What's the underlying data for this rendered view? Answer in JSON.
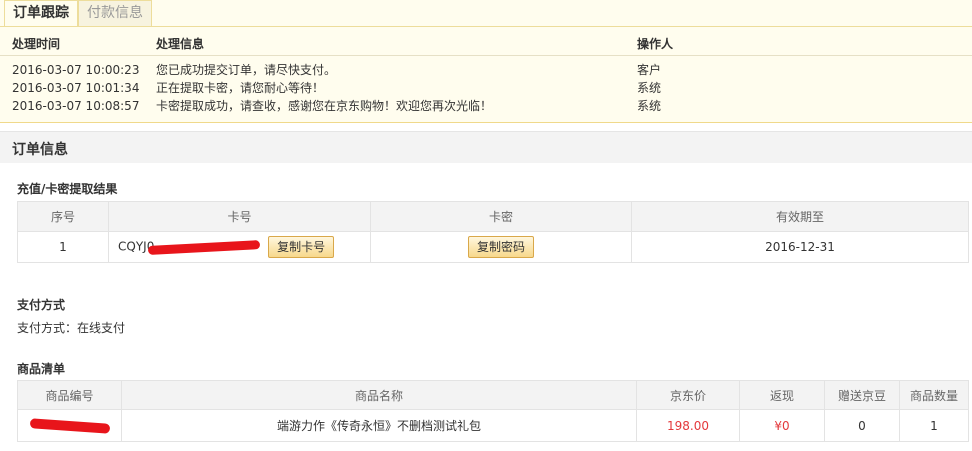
{
  "tabs": {
    "active": "订单跟踪",
    "inactive": "付款信息"
  },
  "track": {
    "headers": {
      "time": "处理时间",
      "info": "处理信息",
      "operator": "操作人"
    },
    "rows": [
      {
        "time": "2016-03-07 10:00:23",
        "info": "您已成功提交订单，请尽快支付。",
        "operator": "客户"
      },
      {
        "time": "2016-03-07 10:01:34",
        "info": "正在提取卡密，请您耐心等待！",
        "operator": "系统"
      },
      {
        "time": "2016-03-07 10:08:57",
        "info": "卡密提取成功，请查收，感谢您在京东购物！欢迎您再次光临！",
        "operator": "系统"
      }
    ]
  },
  "order_info": {
    "title": "订单信息",
    "card_section": {
      "title": "充值/卡密提取结果",
      "headers": {
        "no": "序号",
        "card": "卡号",
        "secret": "卡密",
        "expiry": "有效期至"
      },
      "row": {
        "no": "1",
        "card_prefix": "CQYJ0",
        "copy_card": "复制卡号",
        "copy_secret": "复制密码",
        "expiry": "2016-12-31"
      }
    },
    "payment": {
      "title": "支付方式",
      "text": "支付方式：在线支付"
    },
    "goods": {
      "title": "商品清单",
      "headers": {
        "id": "商品编号",
        "name": "商品名称",
        "price": "京东价",
        "rebate": "返现",
        "beans": "赠送京豆",
        "qty": "商品数量"
      },
      "row": {
        "name": "端游力作《传奇永恒》不删档测试礼包",
        "price": "198.00",
        "rebate": "¥0",
        "beans": "0",
        "qty": "1"
      }
    }
  },
  "colors": {
    "price_red": "#e4393c",
    "redaction": "#e8151b",
    "track_bg": "#fffdee"
  }
}
